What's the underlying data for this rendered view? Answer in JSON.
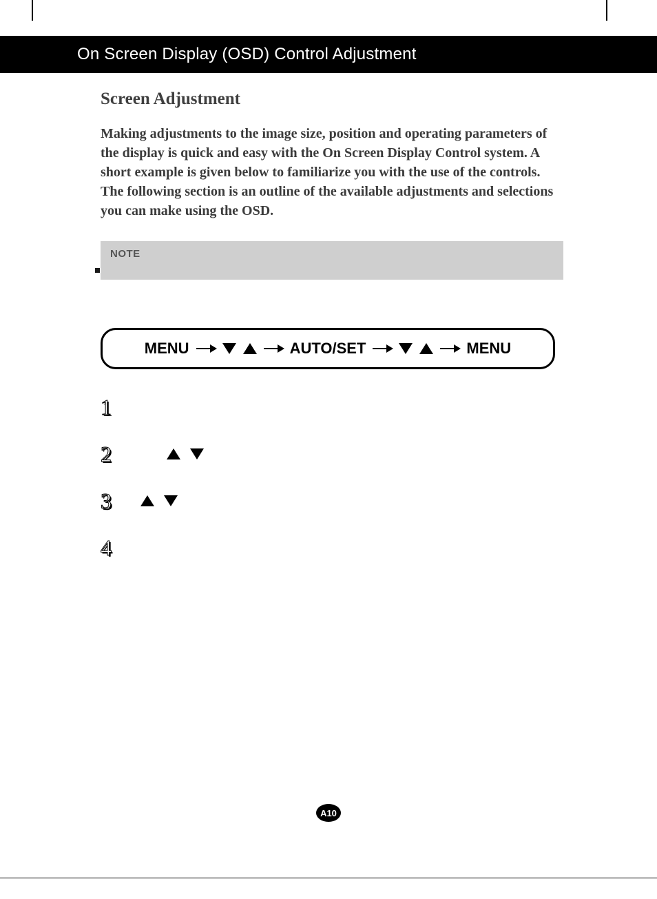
{
  "header": {
    "title": "On Screen Display (OSD) Control Adjustment"
  },
  "section": {
    "title": "Screen Adjustment",
    "intro": "Making adjustments to the image size, position and operating parameters of the display is quick and easy with the On Screen Display Control system. A short example is given below to familiarize you with the use of the controls. The following section is an outline of the available adjustments and selections you can make using the OSD."
  },
  "note": {
    "label": "NOTE"
  },
  "flow": {
    "menu_label": "MENU",
    "autoset_label": "AUTO/SET"
  },
  "steps": {
    "n1": "1",
    "n2": "2",
    "n3": "3",
    "n4": "4"
  },
  "page_number": "A10"
}
